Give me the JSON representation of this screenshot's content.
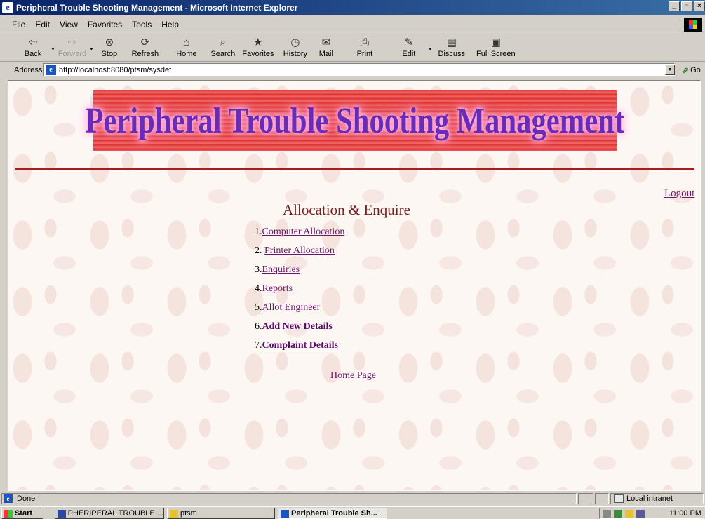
{
  "window": {
    "title": "Peripheral Trouble Shooting Management - Microsoft Internet Explorer",
    "min_glyph": "_",
    "max_glyph": "▫",
    "close_glyph": "×"
  },
  "menubar": {
    "items": [
      "File",
      "Edit",
      "View",
      "Favorites",
      "Tools",
      "Help"
    ]
  },
  "toolbar": {
    "buttons": [
      {
        "label": "Back",
        "icon": "back-arrow-icon",
        "glyph": "⇦",
        "enabled": true
      },
      {
        "label": "Forward",
        "icon": "forward-arrow-icon",
        "glyph": "⇨",
        "enabled": false
      },
      {
        "label": "Stop",
        "icon": "stop-icon",
        "glyph": "⊗",
        "enabled": true
      },
      {
        "label": "Refresh",
        "icon": "refresh-icon",
        "glyph": "⟳",
        "enabled": true
      },
      {
        "label": "Home",
        "icon": "home-icon",
        "glyph": "⌂",
        "enabled": true
      },
      {
        "label": "Search",
        "icon": "search-icon",
        "glyph": "⌕",
        "enabled": true
      },
      {
        "label": "Favorites",
        "icon": "favorites-icon",
        "glyph": "★",
        "enabled": true
      },
      {
        "label": "History",
        "icon": "history-icon",
        "glyph": "◷",
        "enabled": true
      },
      {
        "label": "Mail",
        "icon": "mail-icon",
        "glyph": "✉",
        "enabled": true
      },
      {
        "label": "Print",
        "icon": "print-icon",
        "glyph": "⎙",
        "enabled": true
      },
      {
        "label": "Edit",
        "icon": "edit-icon",
        "glyph": "✎",
        "enabled": true
      },
      {
        "label": "Discuss",
        "icon": "discuss-icon",
        "glyph": "▤",
        "enabled": true
      },
      {
        "label": "Full Screen",
        "icon": "full-screen-icon",
        "glyph": "▣",
        "enabled": true
      }
    ]
  },
  "address": {
    "label": "Address",
    "url": "http://localhost:8080/ptsm/sysdet",
    "go_label": "Go"
  },
  "page": {
    "banner_text": "Peripheral Trouble Shooting Management",
    "logout": "Logout",
    "section_title": "Allocation & Enquire",
    "menu": [
      {
        "num": "1.",
        "label": "Computer Allocation",
        "bold": false
      },
      {
        "num": "2. ",
        "label": "Printer Allocation",
        "bold": false
      },
      {
        "num": "3.",
        "label": "Enquiries",
        "bold": false
      },
      {
        "num": "4.",
        "label": "Reports",
        "bold": false
      },
      {
        "num": "5.",
        "label": "Allot Engineer",
        "bold": false
      },
      {
        "num": "6.",
        "label": "Add New Details",
        "bold": true
      },
      {
        "num": "7.",
        "label": "Complaint Details",
        "bold": true
      }
    ],
    "home_link": "Home Page"
  },
  "statusbar": {
    "status": "Done",
    "zone": "Local intranet"
  },
  "taskbar": {
    "start": "Start",
    "tasks": [
      {
        "label": "PHERIPERAL TROUBLE ...",
        "active": false
      },
      {
        "label": "ptsm",
        "active": false
      },
      {
        "label": "Peripheral Trouble Sh...",
        "active": true
      }
    ],
    "clock": "11:00 PM"
  },
  "colors": {
    "titlebar_start": "#0a246a",
    "link": "#6a1a6a",
    "banner_red": "#e83a3a",
    "banner_text": "#6a2bb8",
    "section_title": "#7a2020",
    "rule": "#a02020"
  }
}
